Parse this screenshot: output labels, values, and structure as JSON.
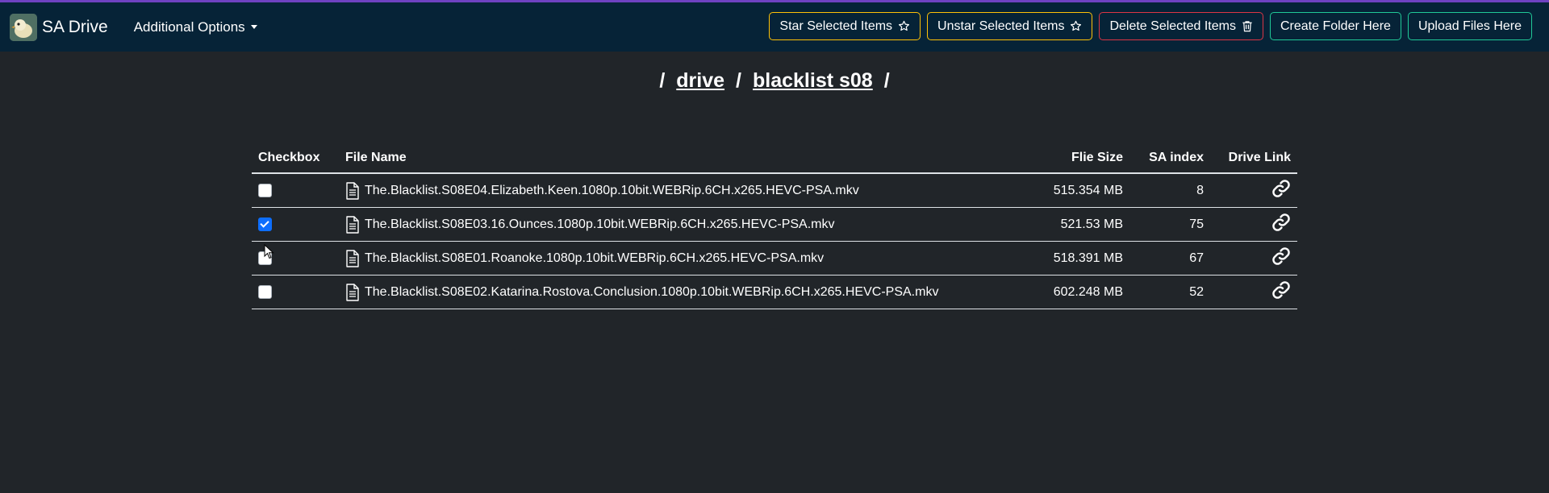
{
  "app": {
    "title": "SA Drive",
    "menu_label": "Additional Options"
  },
  "toolbar": {
    "star_label": "Star Selected Items",
    "unstar_label": "Unstar Selected Items",
    "delete_label": "Delete Selected Items",
    "create_folder_label": "Create Folder Here",
    "upload_label": "Upload Files Here"
  },
  "breadcrumb": {
    "sep": "/",
    "items": [
      "drive",
      "blacklist s08"
    ]
  },
  "table": {
    "headers": {
      "checkbox": "Checkbox",
      "name": "File Name",
      "size": "Flie Size",
      "index": "SA index",
      "link": "Drive Link"
    },
    "rows": [
      {
        "name": "The.Blacklist.S08E04.Elizabeth.Keen.1080p.10bit.WEBRip.6CH.x265.HEVC-PSA.mkv",
        "size": "515.354 MB",
        "index": "8",
        "checked": false
      },
      {
        "name": "The.Blacklist.S08E03.16.Ounces.1080p.10bit.WEBRip.6CH.x265.HEVC-PSA.mkv",
        "size": "521.53 MB",
        "index": "75",
        "checked": true
      },
      {
        "name": "The.Blacklist.S08E01.Roanoke.1080p.10bit.WEBRip.6CH.x265.HEVC-PSA.mkv",
        "size": "518.391 MB",
        "index": "67",
        "checked": false
      },
      {
        "name": "The.Blacklist.S08E02.Katarina.Rostova.Conclusion.1080p.10bit.WEBRip.6CH.x265.HEVC-PSA.mkv",
        "size": "602.248 MB",
        "index": "52",
        "checked": false
      }
    ]
  },
  "colors": {
    "background": "#212529",
    "navbar": "#062337",
    "warning": "#ffc107",
    "danger": "#dc3545",
    "info": "#20c997",
    "checked": "#0d6efd"
  },
  "icons": {
    "star": "star-outline-icon",
    "trash": "trash-icon",
    "file": "file-text-icon",
    "link": "link-icon"
  }
}
